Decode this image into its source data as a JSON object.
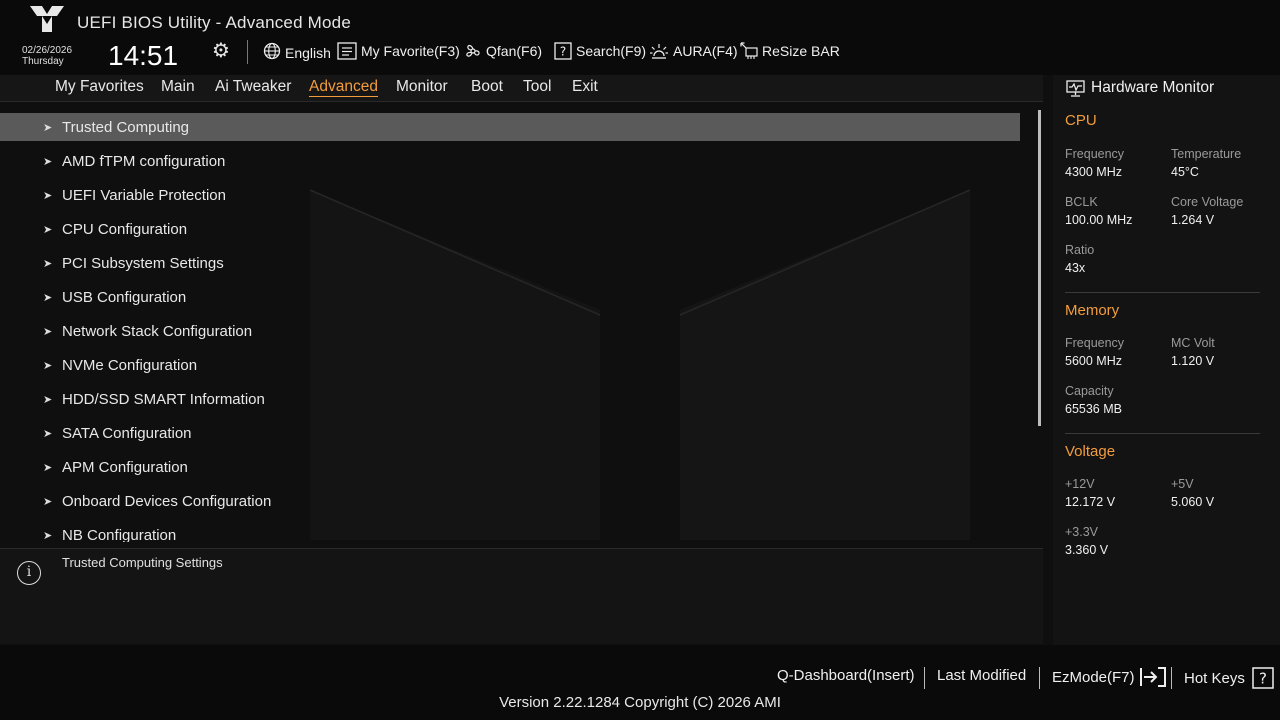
{
  "app": {
    "title": "UEFI BIOS Utility - Advanced Mode"
  },
  "datetime": {
    "date": "02/26/2026",
    "day": "Thursday",
    "time": "14:51"
  },
  "toolbar": {
    "language": "English",
    "my_favorite": "My Favorite(F3)",
    "qfan": "Qfan(F6)",
    "search": "Search(F9)",
    "aura": "AURA(F4)",
    "resize_bar": "ReSize BAR"
  },
  "nav": {
    "active": "Advanced",
    "items": [
      "My Favorites",
      "Main",
      "Ai Tweaker",
      "Advanced",
      "Monitor",
      "Boot",
      "Tool",
      "Exit"
    ]
  },
  "menu": {
    "selected": "Trusted Computing",
    "items": [
      "Trusted Computing",
      "AMD fTPM configuration",
      "UEFI Variable Protection",
      "CPU Configuration",
      "PCI Subsystem Settings",
      "USB Configuration",
      "Network Stack Configuration",
      "NVMe Configuration",
      "HDD/SSD SMART Information",
      "SATA Configuration",
      "APM Configuration",
      "Onboard Devices Configuration",
      "NB Configuration"
    ]
  },
  "help": {
    "text": "Trusted Computing Settings"
  },
  "hardware_monitor": {
    "title": "Hardware Monitor",
    "cpu": {
      "title": "CPU",
      "frequency_label": "Frequency",
      "frequency": "4300 MHz",
      "temperature_label": "Temperature",
      "temperature": "45°C",
      "bclk_label": "BCLK",
      "bclk": "100.00 MHz",
      "core_voltage_label": "Core Voltage",
      "core_voltage": "1.264 V",
      "ratio_label": "Ratio",
      "ratio": "43x"
    },
    "memory": {
      "title": "Memory",
      "frequency_label": "Frequency",
      "frequency": "5600 MHz",
      "mc_volt_label": "MC Volt",
      "mc_volt": "1.120 V",
      "capacity_label": "Capacity",
      "capacity": "65536 MB"
    },
    "voltage": {
      "title": "Voltage",
      "v12_label": "+12V",
      "v12": "12.172 V",
      "v5_label": "+5V",
      "v5": "5.060 V",
      "v33_label": "+3.3V",
      "v33": "3.360 V"
    }
  },
  "footer": {
    "q_dashboard": "Q-Dashboard(Insert)",
    "last_modified": "Last Modified",
    "ezmode": "EzMode(F7)",
    "hot_keys": "Hot Keys",
    "version": "Version 2.22.1284 Copyright (C) 2026 AMI"
  },
  "colors": {
    "accent": "#f39c3d",
    "selected_row": "#5a5a5a",
    "background": "#0f0f0f"
  }
}
